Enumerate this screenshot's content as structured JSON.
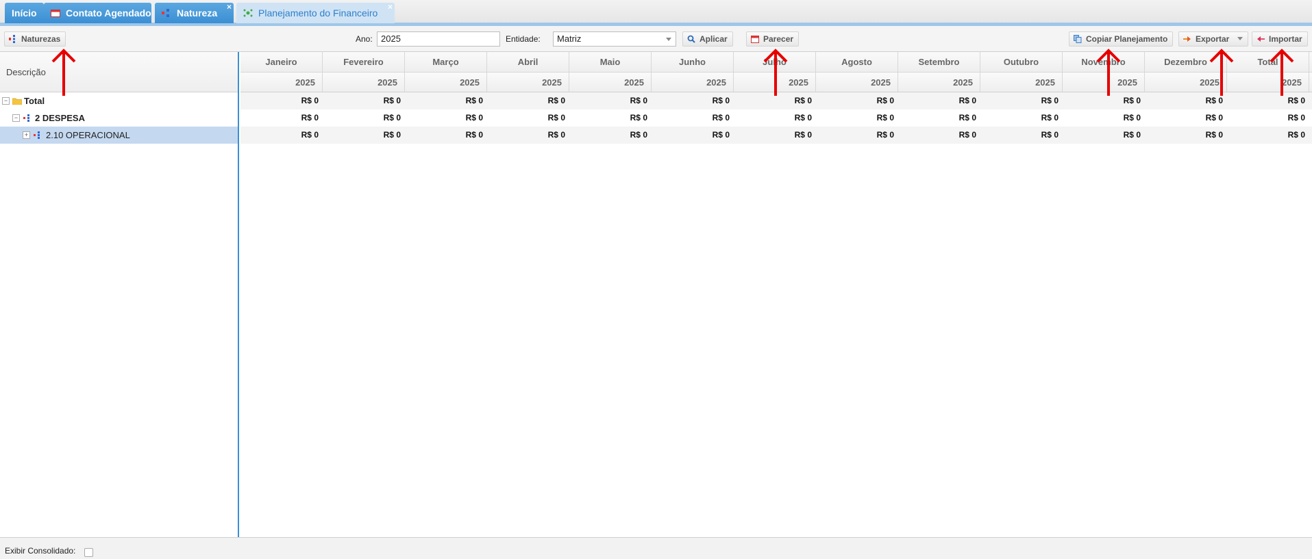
{
  "tabs": [
    {
      "label": "Início",
      "active": false,
      "closable": false
    },
    {
      "label": "Contato Agendado",
      "active": false,
      "closable": false,
      "icon": "calendar-icon"
    },
    {
      "label": "Natureza",
      "active": false,
      "closable": true,
      "icon": "tree-icon"
    },
    {
      "label": "Planejamento do Financeiro",
      "active": true,
      "closable": true,
      "icon": "network-icon"
    }
  ],
  "toolbar": {
    "naturezas_label": "Naturezas",
    "ano_label": "Ano:",
    "ano_value": "2025",
    "entidade_label": "Entidade:",
    "entidade_value": "Matriz",
    "aplicar_label": "Aplicar",
    "parecer_label": "Parecer",
    "copiar_label": "Copiar Planejamento",
    "exportar_label": "Exportar",
    "importar_label": "Importar"
  },
  "tree": {
    "header": "Descrição",
    "rows": [
      {
        "label": "Total",
        "level": 0,
        "icon": "folder-icon",
        "expanded": true,
        "selected": false
      },
      {
        "label": "2 DESPESA",
        "level": 1,
        "icon": "tree-icon",
        "expanded": true,
        "selected": false
      },
      {
        "label": "2.10 OPERACIONAL",
        "level": 2,
        "icon": "tree-icon",
        "expanded": false,
        "selected": true
      }
    ]
  },
  "grid": {
    "months": [
      "Janeiro",
      "Fevereiro",
      "Março",
      "Abril",
      "Maio",
      "Junho",
      "Julho",
      "Agosto",
      "Setembro",
      "Outubro",
      "Novembro",
      "Dezembro",
      "Total"
    ],
    "years": [
      "2025",
      "2025",
      "2025",
      "2025",
      "2025",
      "2025",
      "2025",
      "2025",
      "2025",
      "2025",
      "2025",
      "2025",
      "2025"
    ],
    "rows": [
      [
        "R$ 0",
        "R$ 0",
        "R$ 0",
        "R$ 0",
        "R$ 0",
        "R$ 0",
        "R$ 0",
        "R$ 0",
        "R$ 0",
        "R$ 0",
        "R$ 0",
        "R$ 0",
        "R$ 0"
      ],
      [
        "R$ 0",
        "R$ 0",
        "R$ 0",
        "R$ 0",
        "R$ 0",
        "R$ 0",
        "R$ 0",
        "R$ 0",
        "R$ 0",
        "R$ 0",
        "R$ 0",
        "R$ 0",
        "R$ 0"
      ],
      [
        "R$ 0",
        "R$ 0",
        "R$ 0",
        "R$ 0",
        "R$ 0",
        "R$ 0",
        "R$ 0",
        "R$ 0",
        "R$ 0",
        "R$ 0",
        "R$ 0",
        "R$ 0",
        "R$ 0"
      ]
    ]
  },
  "footer": {
    "consolidado_label": "Exibir Consolidado:",
    "consolidado_checked": false
  },
  "colors": {
    "tab_blue": "#3b8fd3",
    "selection": "#c4d8f0",
    "annotation_arrow": "#e60000"
  }
}
